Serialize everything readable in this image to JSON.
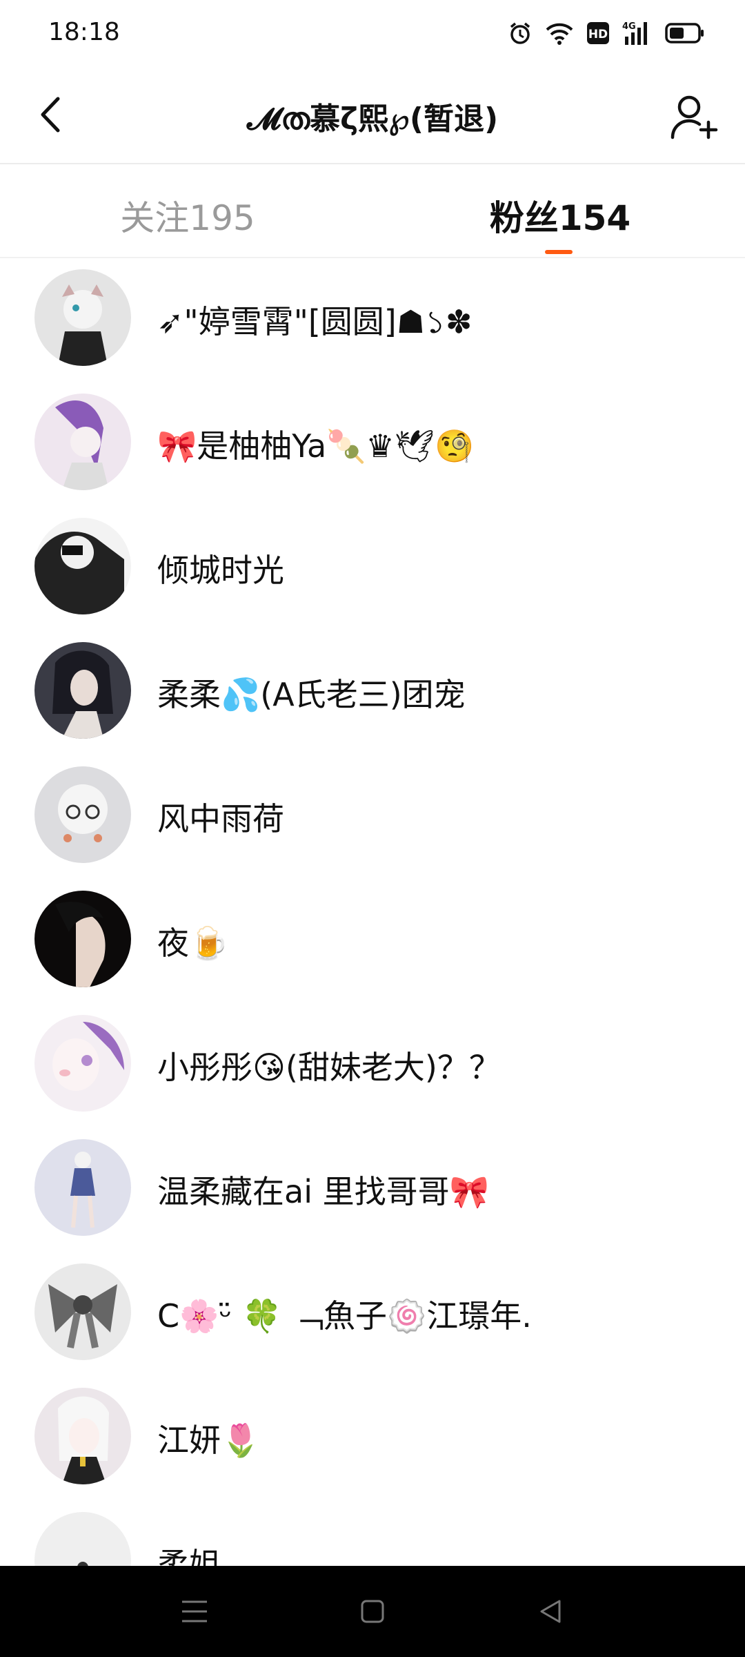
{
  "status_bar": {
    "time": "18:18",
    "icons": [
      "alarm-icon",
      "wifi-icon",
      "hd-icon",
      "4g-signal-icon",
      "battery-icon"
    ],
    "hd_label": "HD",
    "network_label": "4G"
  },
  "header": {
    "title": "𝓜ത慕ζ熙℘(暂退)",
    "back_icon": "chevron-left-icon",
    "add_user_icon": "add-user-icon"
  },
  "tabs": {
    "following": "关注195",
    "followers_prefix": "粉丝",
    "followers_count": "154",
    "active": "followers",
    "accent_color": "#ff5a12"
  },
  "followers": [
    {
      "name": "➶\"婷雪霄\"[圆圆]☗১✽"
    },
    {
      "name": "🎀是柚柚Ya🍡♛🕊🧐"
    },
    {
      "name": "倾城时光"
    },
    {
      "name": "柔柔💦(A氏老三)团宠"
    },
    {
      "name": "风中雨荷"
    },
    {
      "name": "夜🍺"
    },
    {
      "name": "小彤彤😘(甜妹老大)？？"
    },
    {
      "name": "温柔藏在ai 里找哥哥🎀"
    },
    {
      "name": "C🌸ᵕ̈ 🍀 ﹁魚子🍥江璟年."
    },
    {
      "name": "江妍🌷"
    },
    {
      "name": "柔姐"
    }
  ],
  "nav_bar": {
    "buttons": [
      "menu-icon",
      "home-icon",
      "back-triangle-icon"
    ]
  }
}
